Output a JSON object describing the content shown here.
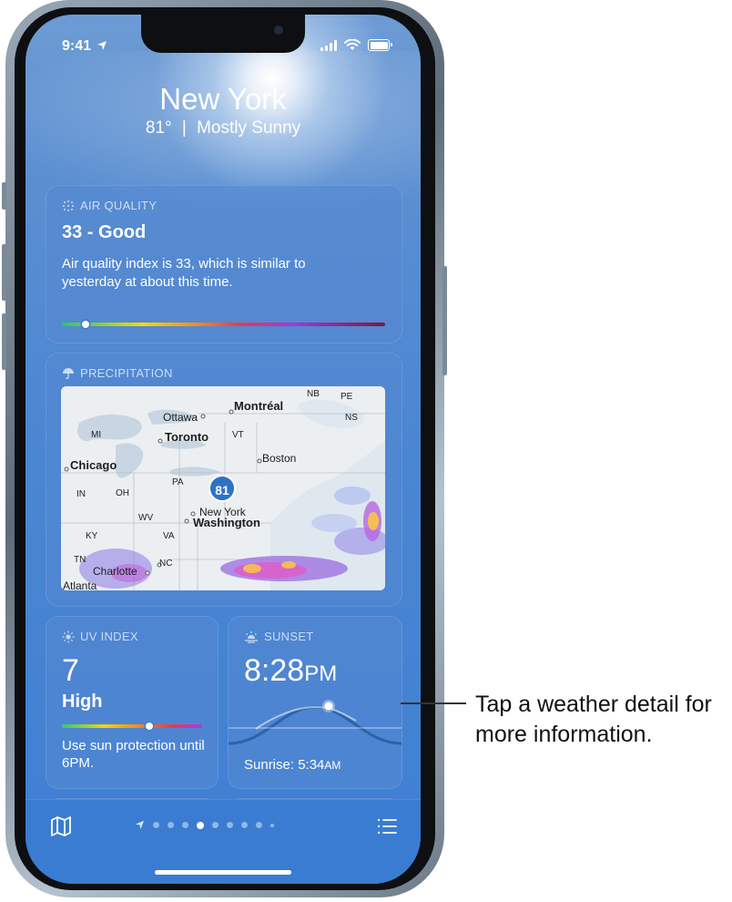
{
  "status_bar": {
    "time": "9:41"
  },
  "location": {
    "city": "New York",
    "temperature": "81°",
    "separator": "|",
    "condition": "Mostly Sunny"
  },
  "air_quality": {
    "title": "AIR QUALITY",
    "value": "33 - Good",
    "description": "Air quality index is 33, which is similar to yesterday at about this time.",
    "level": 0.07
  },
  "precipitation": {
    "title": "PRECIPITATION",
    "pin_value": "81",
    "map_labels": {
      "montreal": "Montréal",
      "ottawa": "Ottawa",
      "toronto": "Toronto",
      "boston": "Boston",
      "chicago": "Chicago",
      "new_york": "New York",
      "washington": "Washington",
      "charlotte": "Charlotte",
      "atlanta": "Atlanta",
      "mi": "MI",
      "vt": "VT",
      "nb": "NB",
      "pe": "PE",
      "ns": "NS",
      "pa": "PA",
      "in": "IN",
      "oh": "OH",
      "wv": "WV",
      "va": "VA",
      "ky": "KY",
      "tn": "TN",
      "nc": "NC"
    }
  },
  "uv_index": {
    "title": "UV INDEX",
    "value": "7",
    "level": "High",
    "description": "Use sun protection until 6PM.",
    "level_fraction": 0.6
  },
  "sunset": {
    "title": "SUNSET",
    "time": "8:28",
    "meridiem": "PM",
    "sunrise_label": "Sunrise: 5:34",
    "sunrise_meridiem": "AM"
  },
  "page_indicator": {
    "count": 9,
    "active_index": 4
  },
  "callout": {
    "text": "Tap a weather detail for more information."
  },
  "colors": {
    "sky": "#4b86d2",
    "card": "#5689d2",
    "accent_pin": "#2f72c4"
  }
}
